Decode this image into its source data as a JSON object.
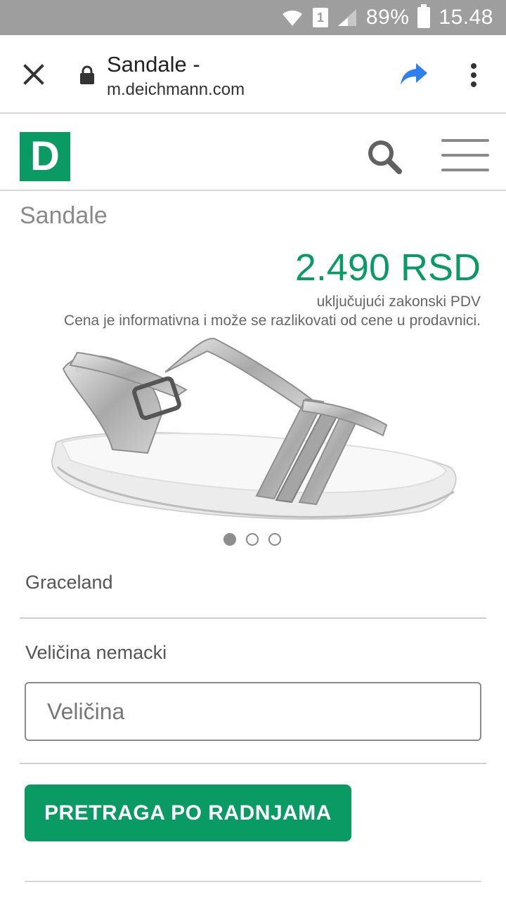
{
  "status_bar": {
    "sim_label": "1",
    "battery_text": "89%",
    "time": "15.48"
  },
  "browser": {
    "page_title": "Sandale -",
    "host": "m.deichmann.com",
    "icons": [
      "close-icon",
      "lock-icon",
      "share-icon",
      "more-vert-icon"
    ],
    "share_color": "#2e7ff0"
  },
  "site": {
    "logo_letter": "D",
    "brand_color": "#0a9a63",
    "icons": [
      "search-icon",
      "hamburger-menu-icon"
    ]
  },
  "product": {
    "title": "Sandale",
    "price": "2.490 RSD",
    "vat_note": "uključujući zakonski PDV",
    "info_note": "Cena je informativna i može se razlikovati od cene u prodavnici.",
    "image_count": 3,
    "active_image_index": 0,
    "brand": "Graceland",
    "size_label": "Veličina nemacki",
    "size_placeholder": "Veličina",
    "store_search_button": "PRETRAGA PO RADNJAMA"
  }
}
